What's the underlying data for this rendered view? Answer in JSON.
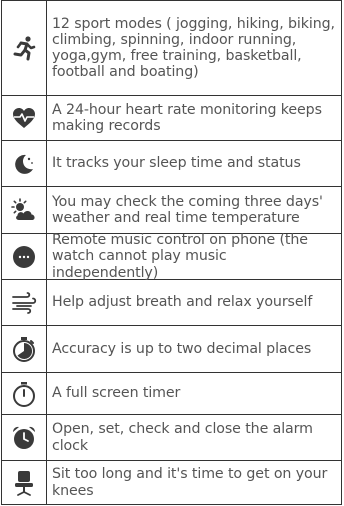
{
  "features": [
    {
      "icon": "running-person-icon",
      "text": "12 sport modes ( jogging, hiking, biking, climbing, spinning, indoor running, yoga,gym, free training, basketball, football and boating)"
    },
    {
      "icon": "heart-rate-icon",
      "text": "A 24-hour heart rate monitoring keeps making records"
    },
    {
      "icon": "moon-stars-icon",
      "text": "It tracks your sleep time and status"
    },
    {
      "icon": "sun-cloud-icon",
      "text": "You may check the coming three days' weather and real time temperature"
    },
    {
      "icon": "music-dots-icon",
      "text": "Remote music control on phone (the watch cannot play music independently)"
    },
    {
      "icon": "breath-wind-icon",
      "text": "Help adjust breath and relax yourself"
    },
    {
      "icon": "stopwatch-icon",
      "text": "Accuracy is up to two decimal places"
    },
    {
      "icon": "timer-icon",
      "text": "A full screen timer"
    },
    {
      "icon": "alarm-clock-icon",
      "text": "Open, set, check and close the alarm clock"
    },
    {
      "icon": "office-chair-icon",
      "text": "Sit too long and it's time to get on your knees"
    }
  ],
  "colors": {
    "icon": "#3a3a3a",
    "text": "#555555",
    "border": "#333333"
  }
}
